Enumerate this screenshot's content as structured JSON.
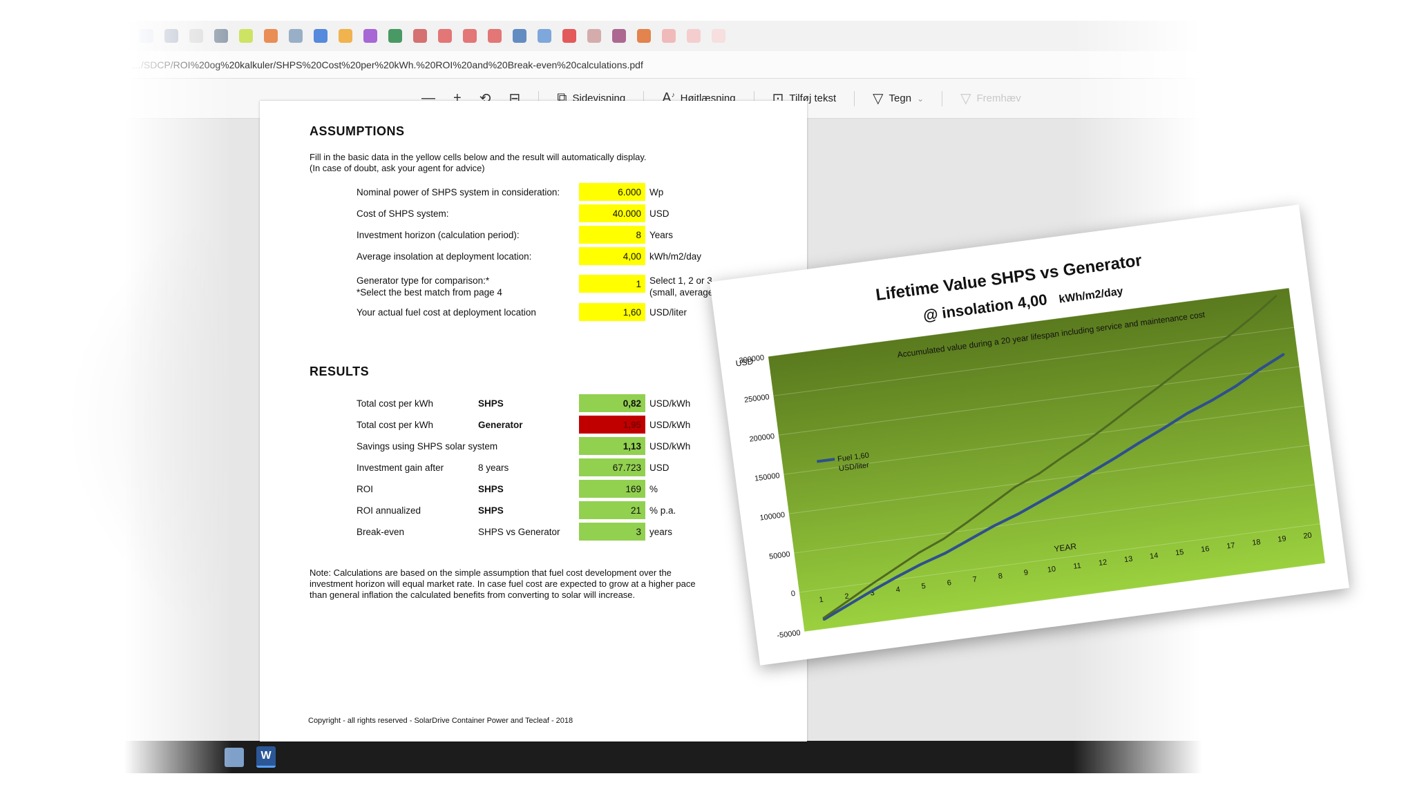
{
  "browser": {
    "address": "…/SDCP/ROI%20og%20kalkuler/SHPS%20Cost%20per%20kWh.%20ROI%20and%20Break-even%20calculations.pdf"
  },
  "toolbar": {
    "zoom_out": "—",
    "zoom_in": "+",
    "page_view": "Sidevisning",
    "read_aloud": "Højtlæsning",
    "add_text": "Tilføj tekst",
    "draw": "Tegn",
    "highlight": "Fremhæv"
  },
  "document": {
    "assumptions_title": "ASSUMPTIONS",
    "intro_line1": "Fill in the basic data in the yellow cells below and the result will automatically display.",
    "intro_line2": "(In case of doubt, ask your agent for advice)",
    "assumptions": [
      {
        "label": "Nominal power of SHPS system in consideration:",
        "value": "6.000",
        "unit": "Wp"
      },
      {
        "label": "Cost of SHPS system:",
        "value": "40.000",
        "unit": "USD"
      },
      {
        "label": "Investment horizon (calculation period):",
        "value": "8",
        "unit": "Years"
      },
      {
        "label": "Average insolation at deployment location:",
        "value": "4,00",
        "unit": "kWh/m2/day"
      }
    ],
    "generator": {
      "label1": "Generator type for comparison:*",
      "label2": "*Select the best match from page 4",
      "value": "1",
      "unit1": "Select 1, 2 or 3",
      "unit2": "(small, average, large)"
    },
    "fuel": {
      "label": "Your actual fuel cost at deployment location",
      "value": "1,60",
      "unit": "USD/liter"
    },
    "results_title": "RESULTS",
    "results": [
      {
        "label": "Total cost per kWh",
        "mid": "SHPS",
        "value": "0,82",
        "unit": "USD/kWh"
      },
      {
        "label": "Total cost per kWh",
        "mid": "Generator",
        "value": "1,95",
        "unit": "USD/kWh"
      },
      {
        "label": "Savings using SHPS solar system",
        "mid": "",
        "value": "1,13",
        "unit": "USD/kWh"
      },
      {
        "label": "Investment gain after",
        "mid": "8 years",
        "value": "67.723",
        "unit": "USD"
      },
      {
        "label": "ROI",
        "mid": "SHPS",
        "value": "169",
        "unit": "%"
      },
      {
        "label": "ROI annualized",
        "mid": "SHPS",
        "value": "21",
        "unit": "% p.a."
      },
      {
        "label": "Break-even",
        "mid": "SHPS vs Generator",
        "value": "3",
        "unit": "years"
      }
    ],
    "note_line1": "Note:  Calculations are based on the simple assumption that fuel cost development over the",
    "note_line2": "investment horizon will equal market rate.  In case fuel cost are expected to grow at a higher pace",
    "note_line3": "than general inflation the calculated benefits from converting to solar will increase.",
    "copyright": "Copyright - all rights reserved - SolarDrive Container Power and Tecleaf - 2018"
  },
  "taskbar": {
    "word_label": "W"
  },
  "chart_data": {
    "type": "line",
    "title_line1": "Lifetime Value SHPS vs Generator",
    "title_line2_a": "@ insolation",
    "title_line2_b": "4,00",
    "title_line2_c": "kWh/m2/day",
    "subtitle": "Accumulated value during a 20 year lifespan including service and maintenance cost",
    "ylabel": "USD",
    "xlabel": "YEAR",
    "ylim": [
      -50000,
      300000
    ],
    "yticks": [
      -50000,
      0,
      50000,
      100000,
      150000,
      200000,
      250000,
      300000
    ],
    "x": [
      1,
      2,
      3,
      4,
      5,
      6,
      7,
      8,
      9,
      10,
      11,
      12,
      13,
      14,
      15,
      16,
      17,
      18,
      19,
      20
    ],
    "series": [
      {
        "name": "Fuel 1,60 USD/liter",
        "color": "#2e4f8f",
        "values": [
          -38000,
          -24000,
          -10000,
          3000,
          15000,
          25000,
          38000,
          51000,
          62000,
          75000,
          88000,
          102000,
          116000,
          131000,
          145000,
          160000,
          172000,
          186000,
          203000,
          218000
        ]
      },
      {
        "values": [
          -36000,
          -19000,
          -2000,
          14000,
          30000,
          43000,
          60000,
          78000,
          96000,
          109000,
          126000,
          142000,
          160000,
          179000,
          197000,
          216000,
          234000,
          250000,
          270000,
          292000
        ],
        "color": "#4f6a22"
      }
    ],
    "legend_position": "left",
    "plot_gradient_top": "#5a7a1e",
    "plot_gradient_bottom": "#9bd13f"
  }
}
